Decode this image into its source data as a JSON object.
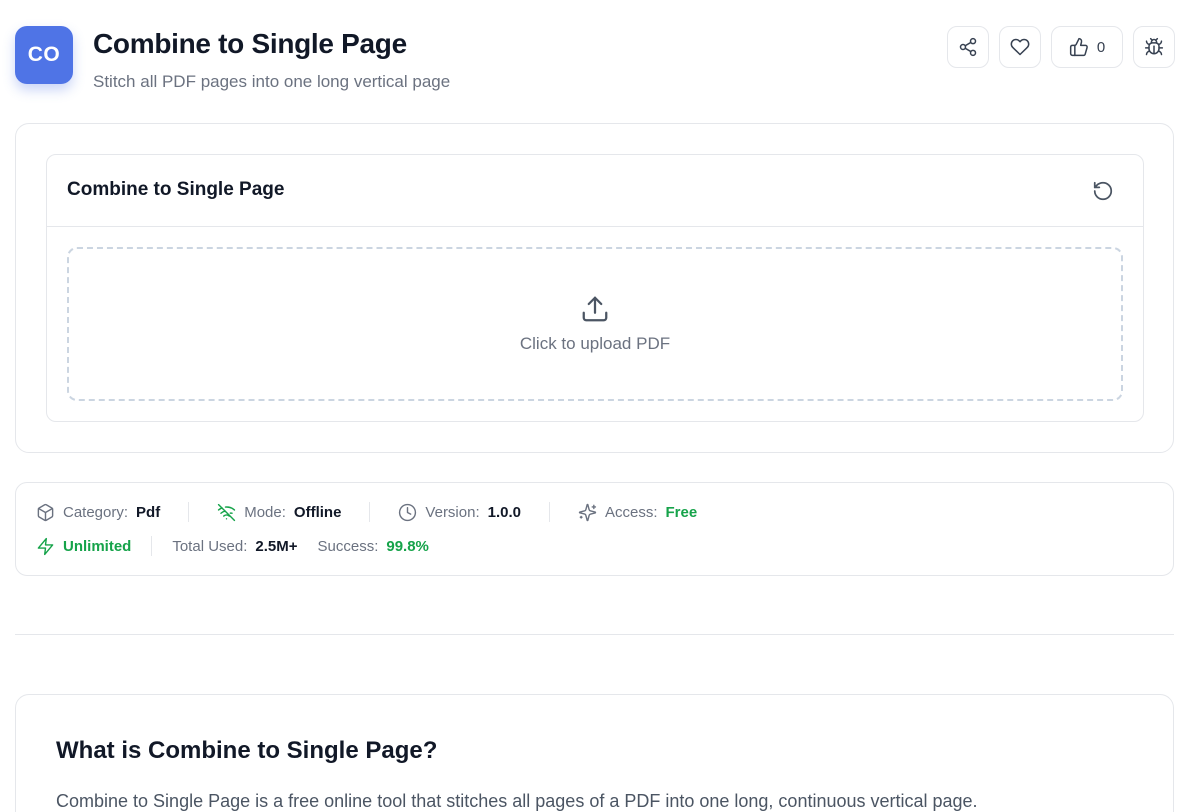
{
  "header": {
    "app_icon_text": "CO",
    "title": "Combine to Single Page",
    "subtitle": "Stitch all PDF pages into one long vertical page",
    "like_count": "0"
  },
  "tool": {
    "card_title": "Combine to Single Page",
    "upload_text": "Click to upload PDF"
  },
  "meta": {
    "category_label": "Category:",
    "category_value": "Pdf",
    "mode_label": "Mode:",
    "mode_value": "Offline",
    "version_label": "Version:",
    "version_value": "1.0.0",
    "access_label": "Access:",
    "access_value": "Free",
    "unlimited": "Unlimited",
    "total_used_label": "Total Used:",
    "total_used_value": "2.5M+",
    "success_label": "Success:",
    "success_value": "99.8%"
  },
  "about": {
    "title": "What is Combine to Single Page?",
    "text": "Combine to Single Page is a free online tool that stitches all pages of a PDF into one long, continuous vertical page."
  },
  "colors": {
    "accent": "#4f74e6",
    "success": "#16a34a"
  }
}
